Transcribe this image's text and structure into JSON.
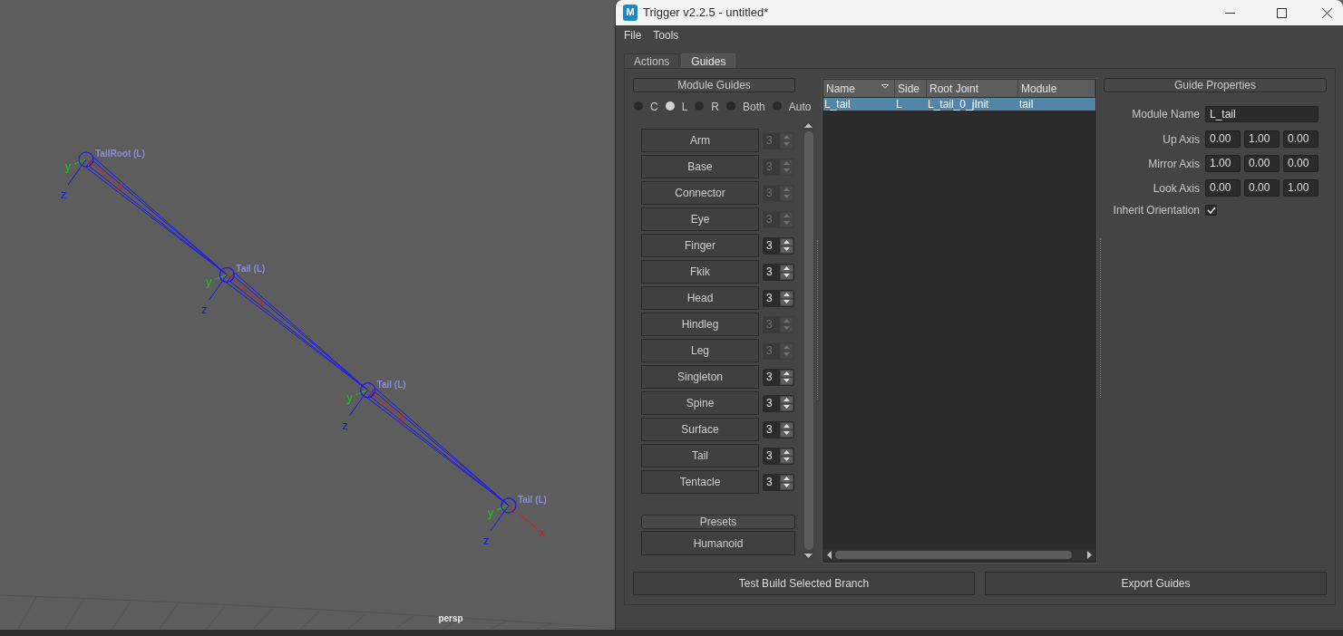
{
  "viewport": {
    "joints": [
      {
        "label": "TailRoot (L)",
        "axis_labels": [
          "x",
          "y",
          "z"
        ]
      },
      {
        "label": "Tail (L)",
        "axis_labels": [
          "x",
          "y",
          "z"
        ]
      },
      {
        "label": "Tail (L)",
        "axis_labels": [
          "x",
          "y",
          "z"
        ]
      },
      {
        "label": "Tail (L)",
        "axis_labels": [
          "x",
          "y",
          "z"
        ]
      }
    ],
    "camera_label": "persp"
  },
  "window": {
    "app_icon_letter": "M",
    "title": "Trigger v2.2.5 - untitled*"
  },
  "menu": [
    "File",
    "Tools"
  ],
  "tabs": [
    {
      "label": "Actions",
      "selected": false
    },
    {
      "label": "Guides",
      "selected": true
    }
  ],
  "module_guides": {
    "header": "Module Guides",
    "sides": [
      {
        "label": "C",
        "selected": false
      },
      {
        "label": "L",
        "selected": true
      },
      {
        "label": "R",
        "selected": false
      },
      {
        "label": "Both",
        "selected": false
      },
      {
        "label": "Auto",
        "selected": false
      }
    ],
    "modules": [
      {
        "label": "Arm",
        "count": "3",
        "spinner_disabled": true
      },
      {
        "label": "Base",
        "count": "3",
        "spinner_disabled": true
      },
      {
        "label": "Connector",
        "count": "3",
        "spinner_disabled": true
      },
      {
        "label": "Eye",
        "count": "3",
        "spinner_disabled": true
      },
      {
        "label": "Finger",
        "count": "3",
        "spinner_disabled": false
      },
      {
        "label": "Fkik",
        "count": "3",
        "spinner_disabled": false
      },
      {
        "label": "Head",
        "count": "3",
        "spinner_disabled": false
      },
      {
        "label": "Hindleg",
        "count": "3",
        "spinner_disabled": true
      },
      {
        "label": "Leg",
        "count": "3",
        "spinner_disabled": true
      },
      {
        "label": "Singleton",
        "count": "3",
        "spinner_disabled": false
      },
      {
        "label": "Spine",
        "count": "3",
        "spinner_disabled": false
      },
      {
        "label": "Surface",
        "count": "3",
        "spinner_disabled": false
      },
      {
        "label": "Tail",
        "count": "3",
        "spinner_disabled": false
      },
      {
        "label": "Tentacle",
        "count": "3",
        "spinner_disabled": false
      }
    ],
    "presets_header": "Presets",
    "presets": [
      "Humanoid"
    ]
  },
  "guides_table": {
    "columns": [
      {
        "label": "Name",
        "sorted": true
      },
      {
        "label": "Side",
        "sorted": false
      },
      {
        "label": "Root Joint",
        "sorted": false
      },
      {
        "label": "Module",
        "sorted": false
      }
    ],
    "rows": [
      {
        "cells": [
          "L_tail",
          "L",
          "L_tail_0_jInit",
          "tail"
        ],
        "selected": true
      }
    ]
  },
  "guide_properties": {
    "header": "Guide Properties",
    "module_name": {
      "label": "Module Name",
      "value": "L_tail"
    },
    "axes": [
      {
        "label": "Up Axis",
        "values": [
          "0.00",
          "1.00",
          "0.00"
        ]
      },
      {
        "label": "Mirror Axis",
        "values": [
          "1.00",
          "0.00",
          "0.00"
        ]
      },
      {
        "label": "Look Axis",
        "values": [
          "0.00",
          "0.00",
          "1.00"
        ]
      }
    ],
    "inherit_orientation": {
      "label": "Inherit Orientation",
      "checked": true
    }
  },
  "buttons": [
    "Test Build Selected Branch",
    "Export Guides"
  ]
}
